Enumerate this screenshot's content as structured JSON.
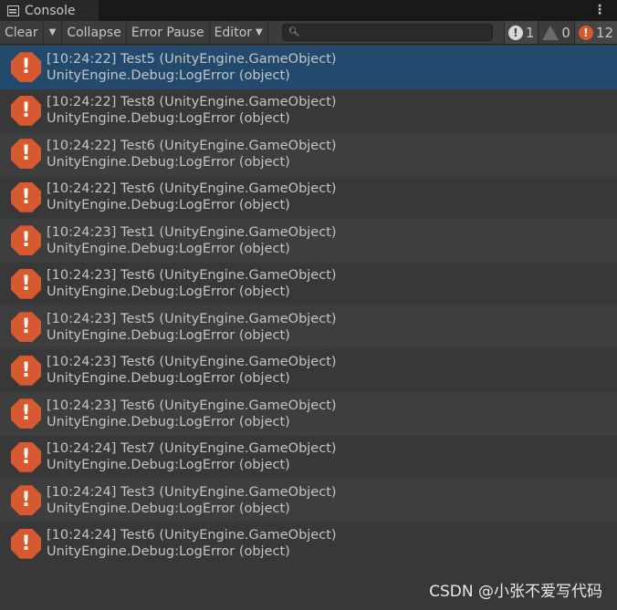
{
  "tab": {
    "title": "Console",
    "icon": "console-icon"
  },
  "toolbar": {
    "clear": "Clear",
    "collapse": "Collapse",
    "error_pause": "Error Pause",
    "editor": "Editor",
    "search_placeholder": "",
    "log_count": "1",
    "warning_count": "0",
    "error_count": "12"
  },
  "colors": {
    "error": "#d6592f",
    "selected": "#234a6c"
  },
  "entries": [
    {
      "line1": "[10:24:22] Test5 (UnityEngine.GameObject)",
      "line2": "UnityEngine.Debug:LogError (object)"
    },
    {
      "line1": "[10:24:22] Test8 (UnityEngine.GameObject)",
      "line2": "UnityEngine.Debug:LogError (object)"
    },
    {
      "line1": "[10:24:22] Test6 (UnityEngine.GameObject)",
      "line2": "UnityEngine.Debug:LogError (object)"
    },
    {
      "line1": "[10:24:22] Test6 (UnityEngine.GameObject)",
      "line2": "UnityEngine.Debug:LogError (object)"
    },
    {
      "line1": "[10:24:23] Test1 (UnityEngine.GameObject)",
      "line2": "UnityEngine.Debug:LogError (object)"
    },
    {
      "line1": "[10:24:23] Test6 (UnityEngine.GameObject)",
      "line2": "UnityEngine.Debug:LogError (object)"
    },
    {
      "line1": "[10:24:23] Test5 (UnityEngine.GameObject)",
      "line2": "UnityEngine.Debug:LogError (object)"
    },
    {
      "line1": "[10:24:23] Test6 (UnityEngine.GameObject)",
      "line2": "UnityEngine.Debug:LogError (object)"
    },
    {
      "line1": "[10:24:23] Test6 (UnityEngine.GameObject)",
      "line2": "UnityEngine.Debug:LogError (object)"
    },
    {
      "line1": "[10:24:24] Test7 (UnityEngine.GameObject)",
      "line2": "UnityEngine.Debug:LogError (object)"
    },
    {
      "line1": "[10:24:24] Test3 (UnityEngine.GameObject)",
      "line2": "UnityEngine.Debug:LogError (object)"
    },
    {
      "line1": "[10:24:24] Test6 (UnityEngine.GameObject)",
      "line2": "UnityEngine.Debug:LogError (object)"
    }
  ],
  "watermark": "CSDN @小张不爱写代码"
}
